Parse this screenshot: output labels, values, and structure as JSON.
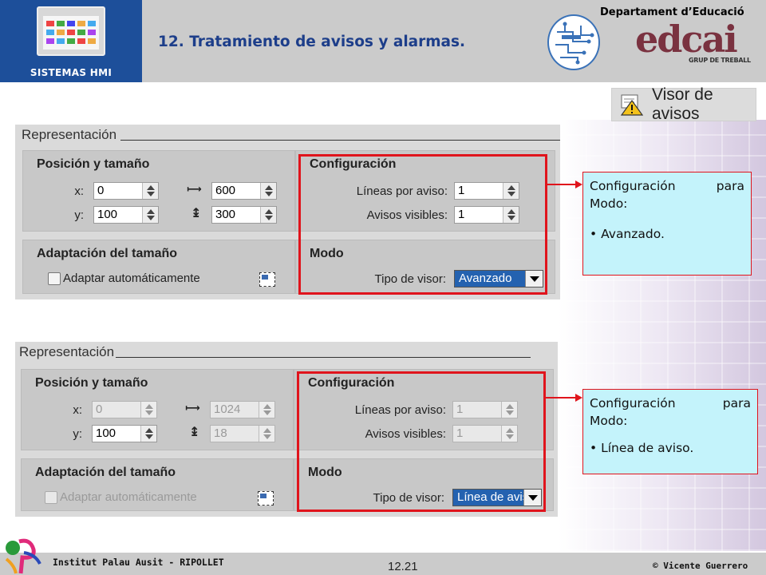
{
  "header": {
    "logo_label": "SISTEMAS HMI",
    "title": "12. Tratamiento de avisos y alarmas.",
    "department": "Departament d’Educació",
    "edcai_logo_text": "edcai",
    "edcai_subtext": "GRUP DE TREBALL"
  },
  "visor_badge": {
    "icon": "warning-icon",
    "label": "Visor de avisos"
  },
  "panels": [
    {
      "heading": "Representación",
      "position": {
        "title": "Posición y tamaño",
        "x_label": "x:",
        "x_value": "0",
        "y_label": "y:",
        "y_value": "100",
        "width_value": "600",
        "height_value": "300",
        "x_disabled": false,
        "width_disabled": false,
        "height_disabled": false
      },
      "adapt": {
        "title": "Adaptación del tamaño",
        "checkbox_label": "Adaptar automáticamente",
        "disabled": false
      },
      "config": {
        "title": "Configuración",
        "lines_label": "Líneas por aviso:",
        "lines_value": "1",
        "visible_label": "Avisos visibles:",
        "visible_value": "1",
        "disabled": false
      },
      "mode": {
        "title": "Modo",
        "viewer_label": "Tipo de visor:",
        "viewer_value": "Avanzado"
      },
      "callout": {
        "line1_a": "Configuración",
        "line1_b": "para",
        "line2": "Modo:",
        "bullet": "• Avanzado."
      }
    },
    {
      "heading": "Representación",
      "position": {
        "title": "Posición y tamaño",
        "x_label": "x:",
        "x_value": "0",
        "y_label": "y:",
        "y_value": "100",
        "width_value": "1024",
        "height_value": "18",
        "x_disabled": true,
        "width_disabled": true,
        "height_disabled": true
      },
      "adapt": {
        "title": "Adaptación del tamaño",
        "checkbox_label": "Adaptar automáticamente",
        "disabled": true
      },
      "config": {
        "title": "Configuración",
        "lines_label": "Líneas por aviso:",
        "lines_value": "1",
        "visible_label": "Avisos visibles:",
        "visible_value": "1",
        "disabled": true
      },
      "mode": {
        "title": "Modo",
        "viewer_label": "Tipo de visor:",
        "viewer_value": "Línea de aviso"
      },
      "callout": {
        "line1_a": "Configuración",
        "line1_b": "para",
        "line2": "Modo:",
        "bullet": "• Línea de aviso."
      }
    }
  ],
  "footer": {
    "institute": "Institut Palau Ausit - RIPOLLET",
    "page": "12.21",
    "author": "© Vicente Guerrero"
  },
  "colors": {
    "header_bg": "#cbcbcb",
    "logo_bg": "#1d4f9a",
    "title": "#1d3e8a",
    "highlight": "#e0141c",
    "callout_bg": "#c4f3fb",
    "select_bg": "#2462b0"
  }
}
